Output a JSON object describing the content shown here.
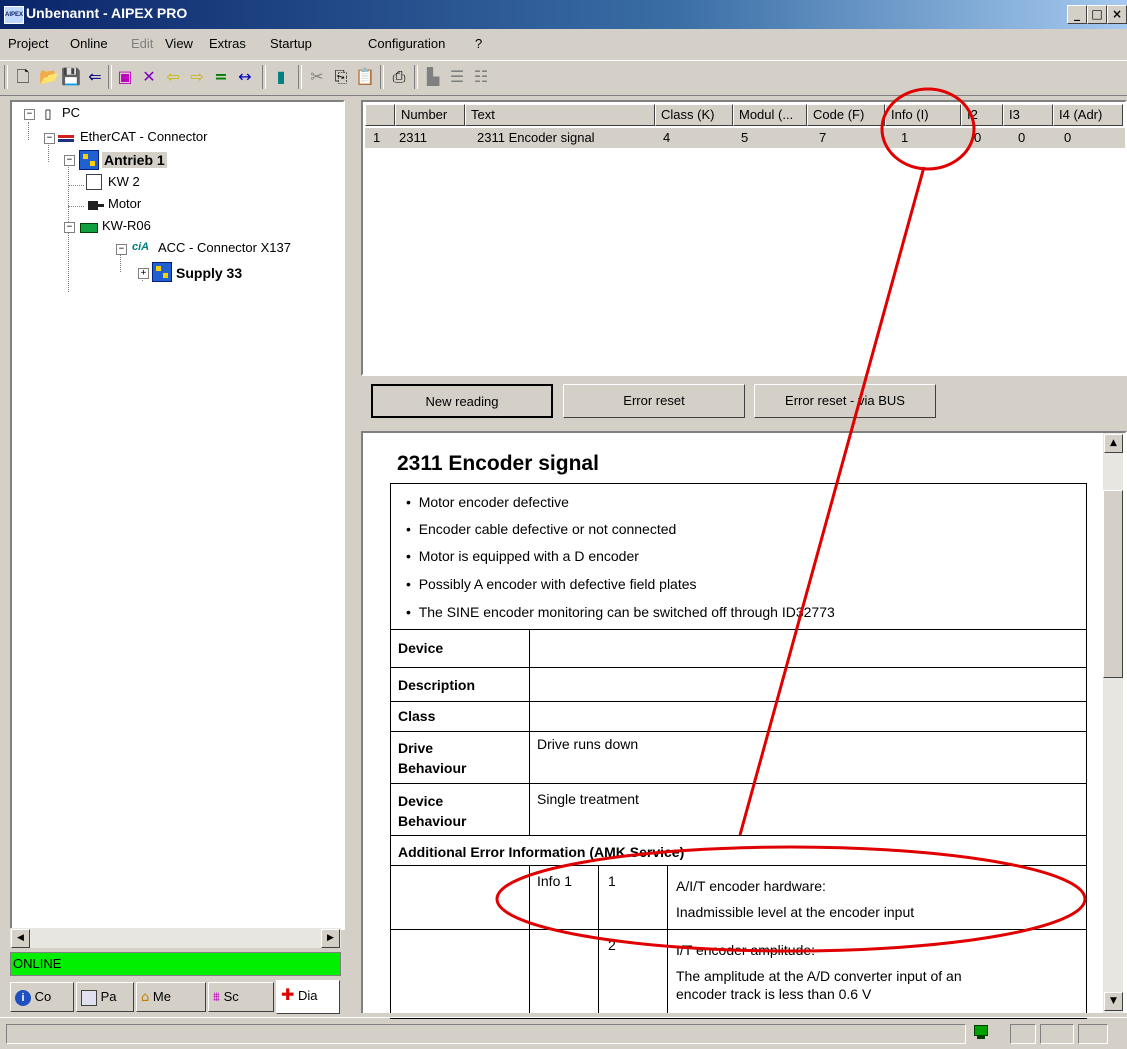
{
  "window": {
    "title": "Unbenannt - AIPEX PRO",
    "app_icon_text": "AIPEX PRO",
    "controls": {
      "minimize": "_",
      "maximize": "□",
      "close": "×"
    }
  },
  "menubar": {
    "items": [
      {
        "label": "Project"
      },
      {
        "label": "Online"
      },
      {
        "label": "Edit"
      },
      {
        "label": "View"
      },
      {
        "label": "Extras"
      },
      {
        "label": "Startup"
      },
      {
        "label": "Configuration"
      },
      {
        "label": "?"
      }
    ]
  },
  "tree": {
    "nodes": [
      {
        "label": "PC",
        "icon": "pc-icon"
      },
      {
        "label": "EtherCAT - Connector",
        "icon": "ethercat-icon"
      },
      {
        "label": "Antrieb 1",
        "icon": "drive-icon"
      },
      {
        "label": "KW 2",
        "icon": "module-icon"
      },
      {
        "label": "Motor",
        "icon": "motor-icon"
      },
      {
        "label": "KW-R06",
        "icon": "board-icon"
      },
      {
        "label": "ACC - Connector X137",
        "icon": "cia-icon",
        "icon_text": "ciA"
      },
      {
        "label": "Supply 33",
        "icon": "supply-icon"
      }
    ]
  },
  "status_online": "ONLINE",
  "bottom_tabs": [
    {
      "label": "Co",
      "icon": "info-icon"
    },
    {
      "label": "Pa",
      "icon": "parameter-icon"
    },
    {
      "label": "Me",
      "icon": "memory-icon"
    },
    {
      "label": "Sc",
      "icon": "scope-icon"
    },
    {
      "label": "Dia",
      "icon": "diagnosis-icon"
    }
  ],
  "table": {
    "columns": [
      "Number",
      "Text",
      "Class (K)",
      "Modul (...",
      "Code (F)",
      "Info (I)",
      "I2",
      "I3",
      "I4 (Adr)"
    ],
    "rows": [
      {
        "index": "1",
        "cells": [
          "2311",
          "2311 Encoder signal",
          "4",
          "5",
          "7",
          "1",
          "0",
          "0",
          "0"
        ]
      }
    ]
  },
  "buttons": {
    "new_reading": "New reading",
    "error_reset": "Error reset",
    "error_reset_bus": "Error reset - via BUS"
  },
  "doc": {
    "title": "2311 Encoder signal",
    "bullets": [
      "Motor encoder defective",
      "Encoder cable defective or not connected",
      "Motor is equipped with a D encoder",
      "Possibly A encoder with defective field plates",
      "The SINE encoder monitoring can be switched off through ID32773"
    ],
    "rows": {
      "device": {
        "label": "Device",
        "value": ""
      },
      "description": {
        "label": "Description",
        "value": ""
      },
      "class": {
        "label": "Class",
        "value": ""
      },
      "drive_behaviour": {
        "label_1": "Drive",
        "label_2": "Behaviour",
        "value": "Drive runs down"
      },
      "device_behaviour": {
        "label_1": "Device",
        "label_2": "Behaviour",
        "value": "Single treatment"
      }
    },
    "additional_header": "Additional Error Information (AMK Service)",
    "info_rows": [
      {
        "info": "Info 1",
        "num": "1",
        "line1": "A/I/T encoder hardware:",
        "line2": "Inadmissible level at the encoder input"
      },
      {
        "info": "",
        "num": "2",
        "line1": "I/T encoder amplitude:",
        "line2": "The amplitude at the A/D converter input of an",
        "line3": "encoder track is less than 0.6 V"
      }
    ]
  },
  "annotation_color": "#e00000"
}
